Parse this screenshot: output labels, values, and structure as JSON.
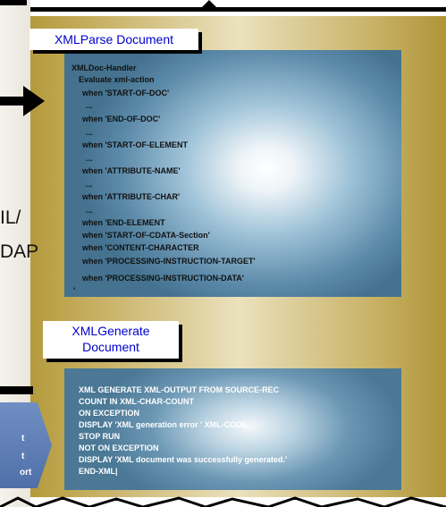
{
  "left_labels": {
    "xml": "IL/",
    "soap": "DAP"
  },
  "chevron": {
    "line1": "t",
    "line2": "t",
    "line3": "ort"
  },
  "parse": {
    "title": "XMLParse Document",
    "lines": [
      "XMLDoc-Handler",
      "Evaluate xml-action",
      "when 'START-OF-DOC'",
      "...",
      "when 'END-OF-DOC'",
      "...",
      "when 'START-OF-ELEMENT",
      "...",
      "when 'ATTRIBUTE-NAME'",
      "...",
      "when 'ATTRIBUTE-CHAR'",
      "...",
      "when 'END-ELEMENT",
      "when 'START-OF-CDATA-Section'",
      "when 'CONTENT-CHARACTER",
      "when 'PROCESSING-INSTRUCTION-TARGET'",
      "when 'PROCESSING-INSTRUCTION-DATA'",
      "'"
    ]
  },
  "generate": {
    "title_line1": "XMLGenerate",
    "title_line2": "Document",
    "lines": [
      "XML GENERATE XML-OUTPUT FROM SOURCE-REC",
      "COUNT IN XML-CHAR-COUNT",
      "ON EXCEPTION",
      "DISPLAY 'XML generation error ' XML-CODE",
      "STOP RUN",
      "NOT ON EXCEPTION",
      "DISPLAY 'XML document was successfully generated.'",
      "END-XML|"
    ]
  }
}
